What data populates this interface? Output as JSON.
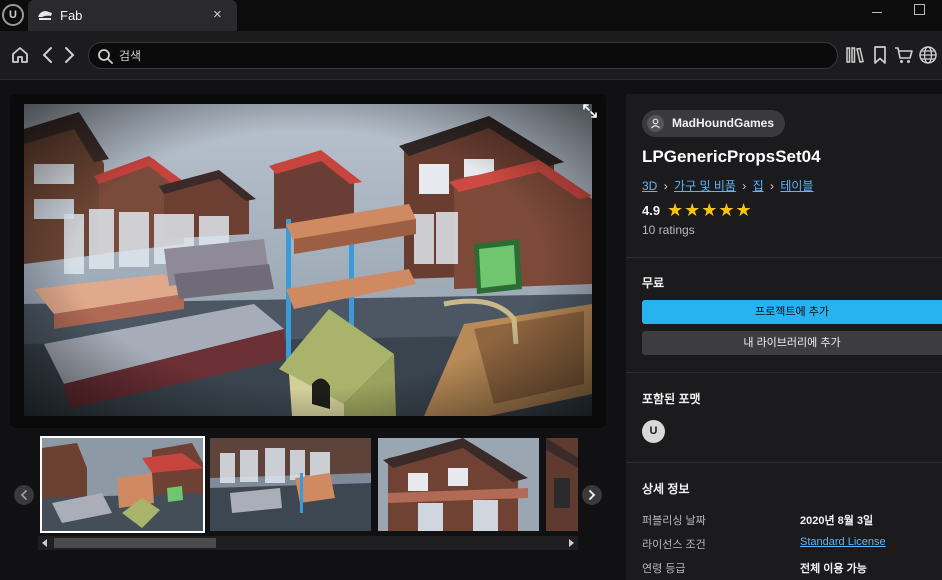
{
  "titlebar": {
    "app_logo": "U",
    "tab_label": "Fab",
    "tab_close": "×"
  },
  "search": {
    "placeholder": "검색"
  },
  "product": {
    "seller": "MadHoundGames",
    "title": "LPGenericPropsSet04",
    "breadcrumbs": [
      "3D",
      "가구 및 비품",
      "집",
      "테이블"
    ],
    "rating": "4.9",
    "stars": "★★★★★",
    "rating_count": "10 ratings"
  },
  "purchase": {
    "price": "무료",
    "add_to_project": "프로젝트에 추가",
    "add_to_library": "내 라이브러리에 추가"
  },
  "formats": {
    "heading": "포함된 포맷",
    "unreal_icon": "U"
  },
  "details": {
    "heading": "상세 정보",
    "rows": [
      {
        "label": "퍼블리싱 날짜",
        "value": "2020년 8월 3일"
      },
      {
        "label": "라이선스 조건",
        "value": "Standard License"
      },
      {
        "label": "연령 등급",
        "value": "전체 이용 가능"
      }
    ]
  },
  "colors": {
    "accent": "#27b3f0",
    "link": "#5fb6f7",
    "star": "#f7c314",
    "panel": "#1b1b1d"
  },
  "icons": [
    "unreal-logo-icon",
    "fab-tab-icon",
    "home-icon",
    "back-icon",
    "forward-icon",
    "search-icon",
    "library-icon",
    "bookmark-icon",
    "cart-icon",
    "globe-icon",
    "expand-icon",
    "chevron-left-icon",
    "chevron-right-icon",
    "user-icon",
    "unreal-format-icon"
  ]
}
